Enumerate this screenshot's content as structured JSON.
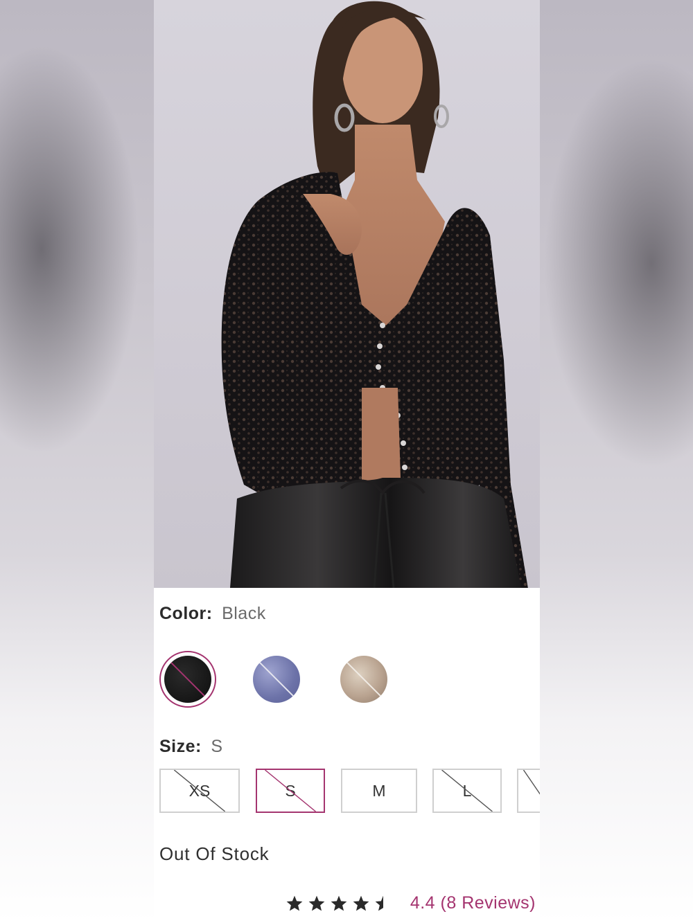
{
  "product": {
    "color_label": "Color:",
    "color_value": "Black",
    "swatches": [
      {
        "name": "Black",
        "color": "#1a1a1a",
        "selected": true,
        "unavailable": true
      },
      {
        "name": "Blue",
        "color": "#7f86b8",
        "selected": false,
        "unavailable": true
      },
      {
        "name": "Beige",
        "color": "#c9b9a6",
        "selected": false,
        "unavailable": true
      }
    ],
    "size_label": "Size:",
    "size_value": "S",
    "sizes": [
      {
        "label": "XS",
        "selected": false,
        "unavailable": true
      },
      {
        "label": "S",
        "selected": true,
        "unavailable": true
      },
      {
        "label": "M",
        "selected": false,
        "unavailable": false
      },
      {
        "label": "L",
        "selected": false,
        "unavailable": true
      },
      {
        "label": "",
        "selected": false,
        "unavailable": true
      }
    ],
    "stock_status": "Out Of Stock",
    "rating": {
      "stars": 4.4,
      "text": "4.4 (8 Reviews)"
    }
  },
  "colors": {
    "accent": "#a4346f",
    "border": "#cfcfcf"
  }
}
